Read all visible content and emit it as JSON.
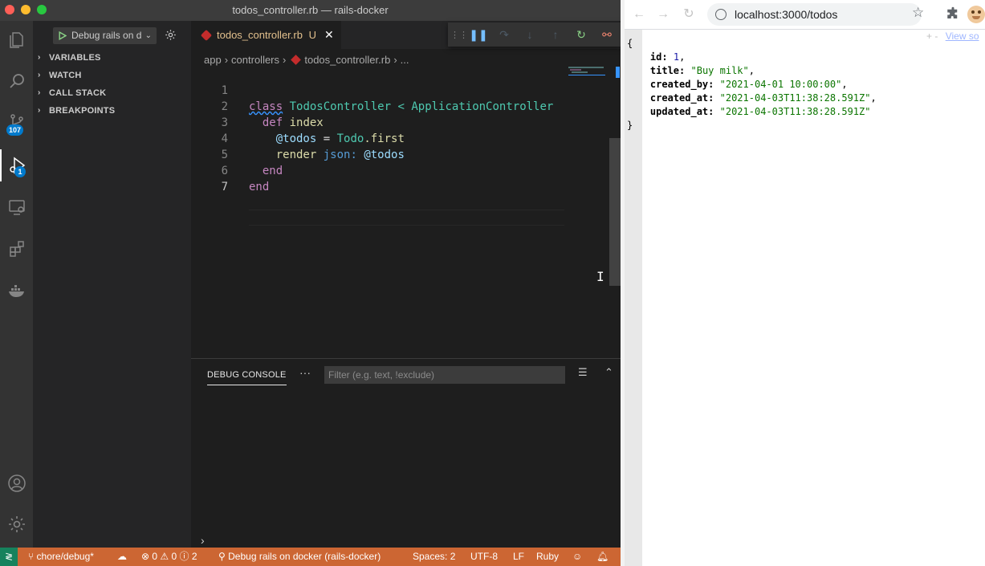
{
  "window": {
    "title": "todos_controller.rb — rails-docker"
  },
  "activity_bar": {
    "scm_badge": "107",
    "debug_badge": "1"
  },
  "sidebar": {
    "launch_config": "Debug rails on d",
    "sections": [
      "VARIABLES",
      "WATCH",
      "CALL STACK",
      "BREAKPOINTS"
    ]
  },
  "editor": {
    "tab_label": "todos_controller.rb",
    "tab_status": "U",
    "breadcrumb": [
      "app",
      "controllers",
      "todos_controller.rb",
      "..."
    ],
    "lines": [
      {
        "num": "1"
      },
      {
        "num": "2"
      },
      {
        "num": "3"
      },
      {
        "num": "4"
      },
      {
        "num": "5"
      },
      {
        "num": "6"
      },
      {
        "num": "7"
      }
    ],
    "code": {
      "l1_kw": "class",
      "l1_cls": "TodosController",
      "l1_op": "<",
      "l1_parent": "ApplicationController",
      "l2_kw": "def",
      "l2_meth": "index",
      "l3_ivar": "@todos",
      "l3_op": "=",
      "l3_cls": "Todo",
      "l3_meth": ".first",
      "l4_meth": "render",
      "l4_sym": "json:",
      "l4_ivar": "@todos",
      "l5_kw": "end",
      "l6_kw": "end"
    }
  },
  "panel": {
    "tab_label": "DEBUG CONSOLE",
    "more": "···",
    "filter_placeholder": "Filter (e.g. text, !exclude)",
    "prompt": "›"
  },
  "statusbar": {
    "branch": "chore/debug*",
    "errors": "0",
    "warnings": "0",
    "infos": "2",
    "debug_target": "Debug rails on docker (rails-docker)",
    "spaces": "Spaces: 2",
    "encoding": "UTF-8",
    "eol": "LF",
    "language": "Ruby"
  },
  "browser": {
    "url": "localhost:3000/todos",
    "view_source": "View so",
    "view_source_prefix": "+  -",
    "json_lines": {
      "open": "{",
      "close": "}",
      "id_key": "id:",
      "id_val": "1",
      "title_key": "title:",
      "title_val": "\"Buy milk\"",
      "created_by_key": "created_by:",
      "created_by_val": "\"2021-04-01 10:00:00\"",
      "created_at_key": "created_at:",
      "created_at_val": "\"2021-04-03T11:38:28.591Z\"",
      "updated_at_key": "updated_at:",
      "updated_at_val": "\"2021-04-03T11:38:28.591Z\""
    }
  },
  "colors": {
    "statusbar_bg": "#cc6633",
    "remote_bg": "#16825d",
    "badge": "#007acc"
  }
}
